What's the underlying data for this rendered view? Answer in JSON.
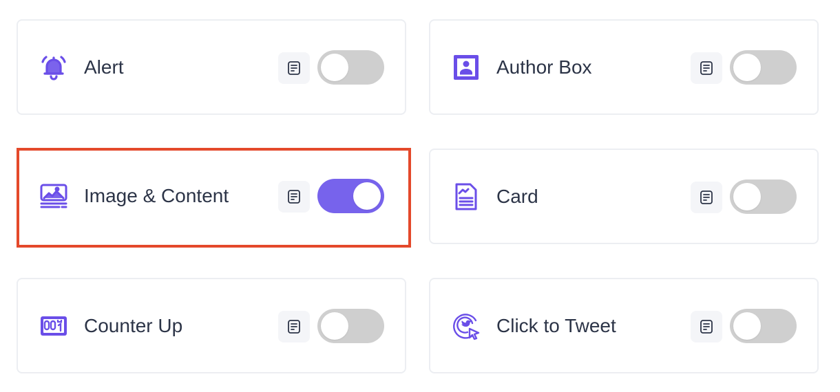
{
  "colors": {
    "accent": "#7763ec",
    "toggle_off": "#cfcfcf",
    "highlight_border": "#e4492b",
    "label_text": "#2c3447"
  },
  "widgets": [
    {
      "label": "Alert",
      "icon": "bell-icon",
      "enabled": false,
      "highlighted": false
    },
    {
      "label": "Author Box",
      "icon": "author-box-icon",
      "enabled": false,
      "highlighted": false
    },
    {
      "label": "Image & Content",
      "icon": "image-content-icon",
      "enabled": true,
      "highlighted": true
    },
    {
      "label": "Card",
      "icon": "card-icon",
      "enabled": false,
      "highlighted": false
    },
    {
      "label": "Counter Up",
      "icon": "counter-up-icon",
      "enabled": false,
      "highlighted": false
    },
    {
      "label": "Click to Tweet",
      "icon": "click-to-tweet-icon",
      "enabled": false,
      "highlighted": false
    }
  ],
  "doc_icon": "document-icon"
}
